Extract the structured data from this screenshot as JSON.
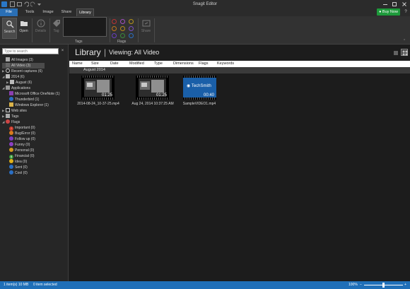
{
  "window": {
    "title": "Snagit Editor"
  },
  "tabs": [
    {
      "label": "File"
    },
    {
      "label": "Tools"
    },
    {
      "label": "Image"
    },
    {
      "label": "Share"
    },
    {
      "label": "Library"
    }
  ],
  "buy_now_label": "Buy Now",
  "ribbon": {
    "search_label": "Search",
    "open_label": "Open",
    "details_label": "Details",
    "tag_label": "Tag",
    "share_label": "Share",
    "tags_group_label": "Tags",
    "flags_group_label": "Flags"
  },
  "search": {
    "placeholder": "Type to search"
  },
  "tree": {
    "all_images": "All Images (3)",
    "all_video": "All Video (3)",
    "recent": "Recent captures (6)",
    "year": "2014 (6)",
    "month": "August (6)",
    "applications": "Applications",
    "app1": "Microsoft Office OneNote (1)",
    "app2": "Thunderbird (1)",
    "app3": "Windows Explorer (1)",
    "websites": "Web sites",
    "tags": "Tags",
    "flags": "Flags",
    "flag_items": [
      {
        "label": "Important (0)",
        "color": "#d23a2a"
      },
      {
        "label": "Bug/Error (0)",
        "color": "#d87a1e"
      },
      {
        "label": "Follow up (0)",
        "color": "#7a3ec2"
      },
      {
        "label": "Funny (0)",
        "color": "#8b3fc4"
      },
      {
        "label": "Personal (0)",
        "color": "#d49a1e"
      },
      {
        "label": "Financial (0)",
        "color": "#3a9a3a"
      },
      {
        "label": "Idea (0)",
        "color": "#e0b21a"
      },
      {
        "label": "Sent (0)",
        "color": "#2a6fc4"
      },
      {
        "label": "Cool (0)",
        "color": "#2a6fc4"
      }
    ]
  },
  "library": {
    "title": "Library",
    "separator": "|",
    "viewing": "Viewing: All Video",
    "columns": [
      "Name",
      "Size",
      "Date",
      "Modified",
      "Type",
      "Dimensions",
      "Flags",
      "Keywords"
    ],
    "group": "August 2014",
    "items": [
      {
        "name": "2014-08-24_10-37-25.mp4",
        "duration": "01:25"
      },
      {
        "name": "Aug 24, 2014 10:37:25 AM",
        "duration": "01:25"
      },
      {
        "name": "SampleVIDEO1.mp4",
        "duration": "00:40",
        "brand": "TechSmith"
      }
    ]
  },
  "status": {
    "left": "1 item(s) 10 MB",
    "selected": "0 item selected",
    "zoom": "100%",
    "zoom_minus": "−",
    "zoom_plus": "+",
    "zoom_fraction": 0.5
  }
}
